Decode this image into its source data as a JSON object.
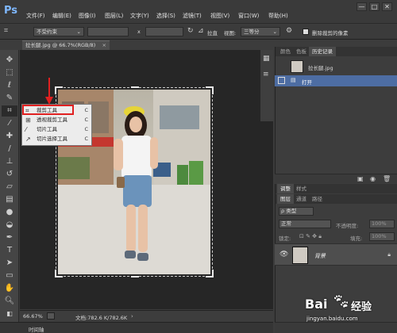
{
  "app": {
    "logo": "Ps"
  },
  "menu": [
    "文件(F)",
    "编辑(E)",
    "图像(I)",
    "图层(L)",
    "文字(Y)",
    "选择(S)",
    "滤镜(T)",
    "视图(V)",
    "窗口(W)",
    "帮助(H)"
  ],
  "window_controls": [
    "—",
    "□",
    "✕"
  ],
  "options_bar": {
    "ratio_value": "不受约束",
    "swap_symbol": "x",
    "straighten_label": "拉直",
    "view_label": "视图:",
    "view_value": "三等分",
    "delete_cropped_label": "删除裁剪的像素"
  },
  "document": {
    "tab_title": "拉长腿.jpg @ 66.7%(RGB/8)",
    "tab_close": "×",
    "zoom": "66.67%",
    "doc_info": "文档:782.6 K/782.6K",
    "timeline_label": "时间轴"
  },
  "flyout": {
    "items": [
      {
        "label": "裁剪工具",
        "key": "C",
        "icon": "crop-icon"
      },
      {
        "label": "透视裁剪工具",
        "key": "C",
        "icon": "perspective-crop-icon"
      },
      {
        "label": "切片工具",
        "key": "C",
        "icon": "slice-icon"
      },
      {
        "label": "切片选择工具",
        "key": "C",
        "icon": "slice-select-icon"
      }
    ]
  },
  "history_panel": {
    "tabs": [
      "颜色",
      "色板",
      "历史记录"
    ],
    "snapshot_name": "拉长腿.jpg",
    "steps": [
      "打开"
    ]
  },
  "layers_panel": {
    "tabs_top": [
      "调整",
      "样式"
    ],
    "tabs": [
      "图层",
      "通道",
      "路径"
    ],
    "filter_label": "ρ 类型",
    "blend_mode": "正常",
    "opacity_label": "不透明度:",
    "opacity_value": "100%",
    "lock_label": "锁定:",
    "fill_label": "填充:",
    "fill_value": "100%",
    "layer_name": "背景"
  },
  "watermark": {
    "brand": "Bai",
    "brand2": "经验",
    "url": "jingyan.baidu.com"
  },
  "colors": {
    "accent_selection": "#4d6da3",
    "highlight_red": "#e02020",
    "logo_blue": "#7fb8ff"
  }
}
